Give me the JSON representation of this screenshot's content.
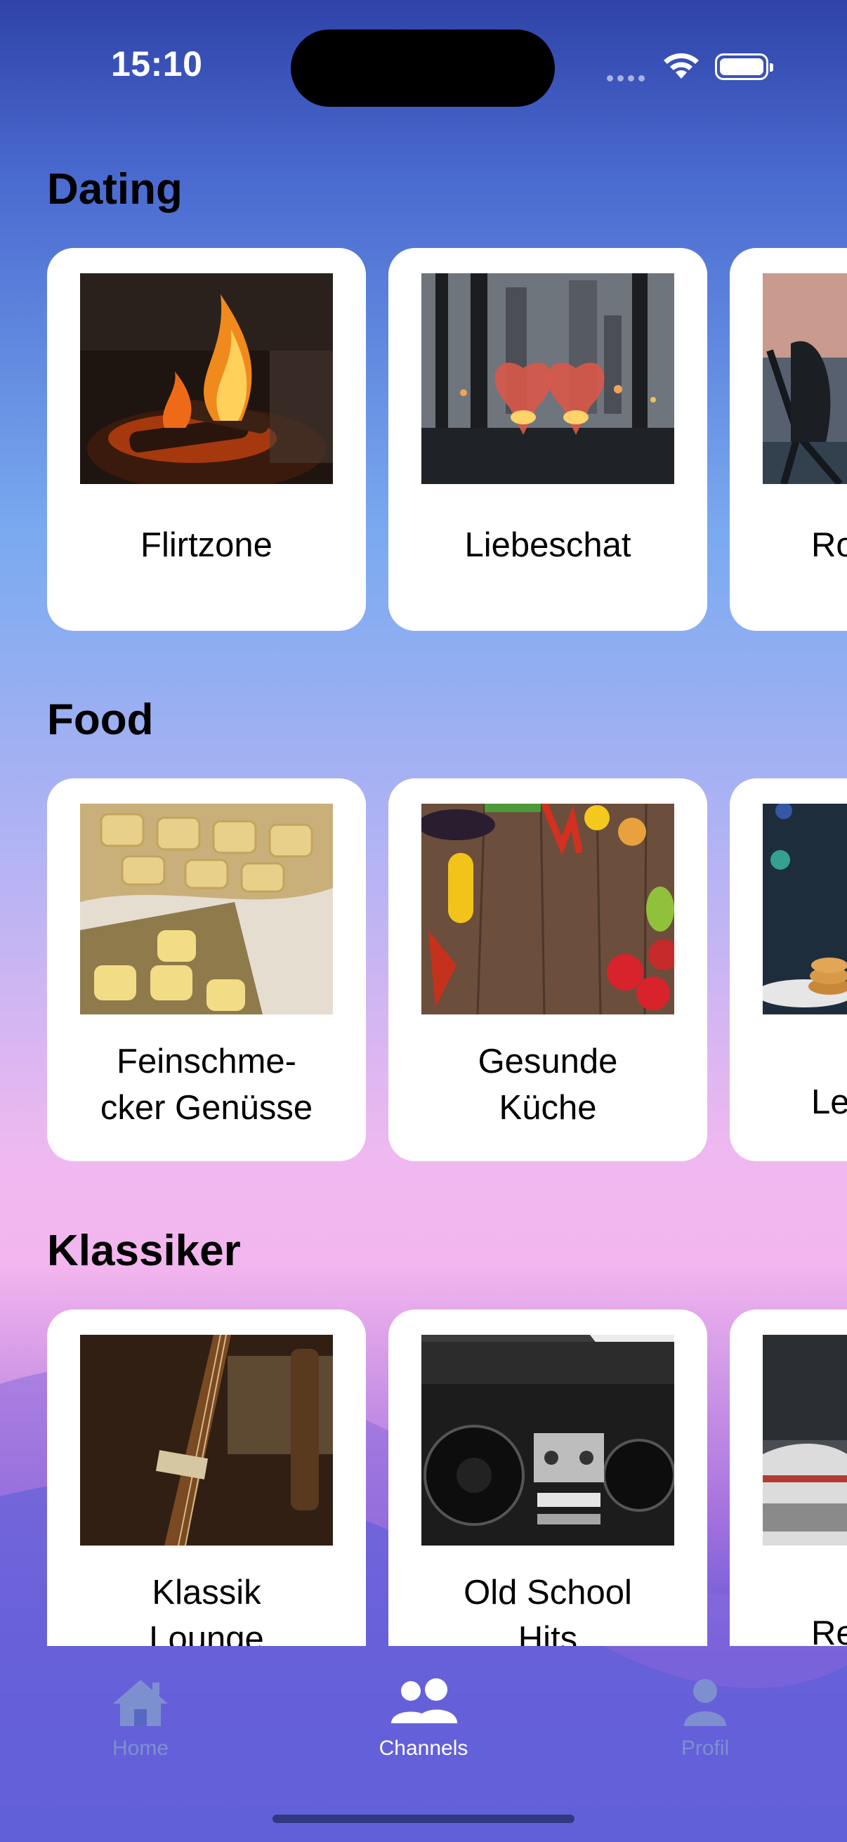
{
  "status_bar": {
    "time": "15:10"
  },
  "sections": [
    {
      "title": "Dating",
      "cards": [
        {
          "label": "Flirtzone"
        },
        {
          "label": "Liebeschat"
        },
        {
          "label": "Ro"
        }
      ]
    },
    {
      "title": "Food",
      "cards": [
        {
          "label": "Feinschme-\ncker Genüsse"
        },
        {
          "label": "Gesunde\nKüche"
        },
        {
          "label": "Lec"
        }
      ]
    },
    {
      "title": "Klassiker",
      "cards": [
        {
          "label": "Klassik\nLounge"
        },
        {
          "label": "Old School\nHits"
        },
        {
          "label": "Ret"
        }
      ]
    }
  ],
  "tab_bar": {
    "items": [
      {
        "label": "Home",
        "icon": "house-icon",
        "active": false
      },
      {
        "label": "Channels",
        "icon": "people-icon",
        "active": true
      },
      {
        "label": "Profil",
        "icon": "person-icon",
        "active": false
      }
    ]
  }
}
